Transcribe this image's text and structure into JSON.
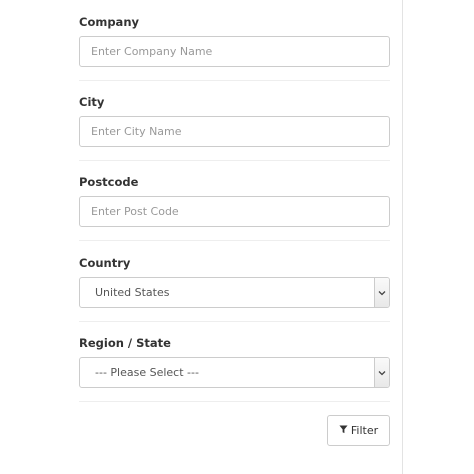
{
  "form": {
    "company": {
      "label": "Company",
      "placeholder": "Enter Company Name"
    },
    "city": {
      "label": "City",
      "placeholder": "Enter City Name"
    },
    "postcode": {
      "label": "Postcode",
      "placeholder": "Enter Post Code"
    },
    "country": {
      "label": "Country",
      "selected": "United States"
    },
    "region": {
      "label": "Region / State",
      "selected": "--- Please Select ---"
    },
    "filter_button": {
      "label": "Filter",
      "icon": "filter-icon"
    }
  }
}
